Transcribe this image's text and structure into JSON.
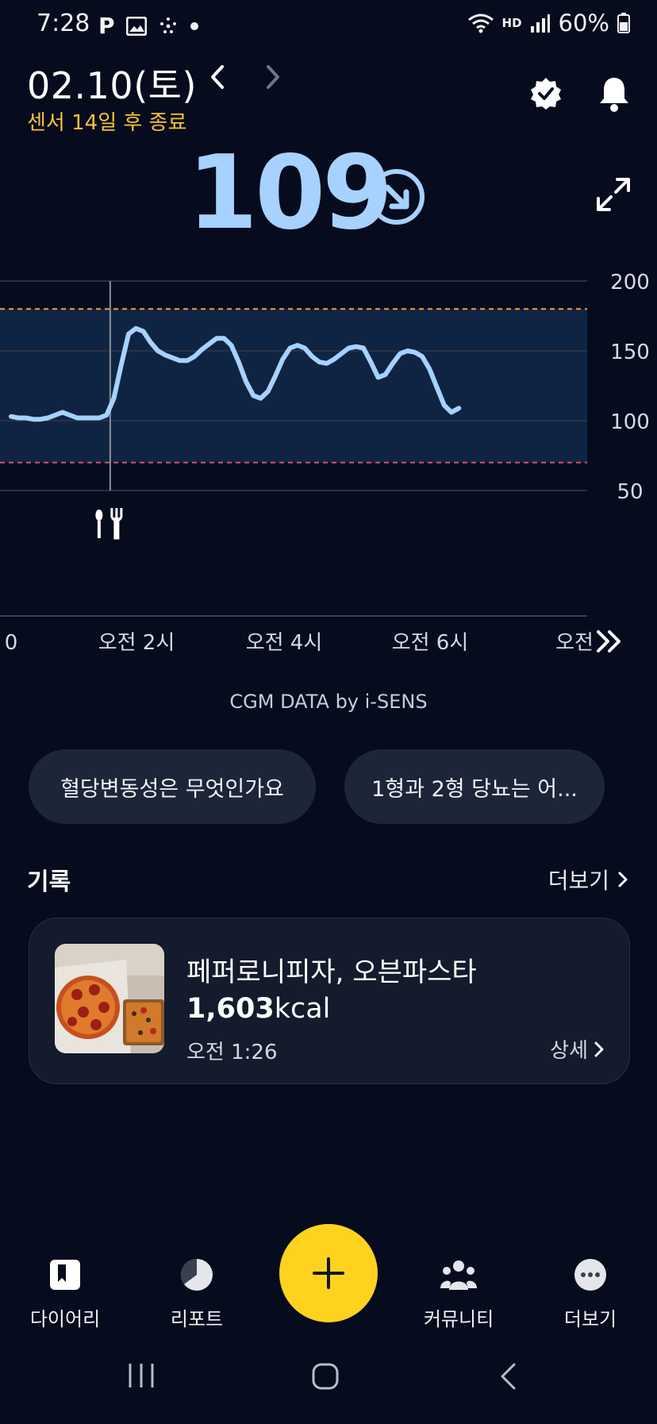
{
  "status_bar": {
    "time": "7:28",
    "battery": "60%",
    "network_label": "HD"
  },
  "header": {
    "date": "02.10(토)",
    "sensor_notice": "센서 14일 후 종료"
  },
  "glucose": {
    "value": "109",
    "trend": "falling"
  },
  "chart_data": {
    "type": "line",
    "yticks": [
      200,
      150,
      100,
      50
    ],
    "ylim": [
      35,
      200
    ],
    "xticks": [
      "0",
      "오전 2시",
      "오전 4시",
      "오전 6시",
      "오전"
    ],
    "target_range": [
      70,
      180
    ],
    "hours": [
      0.0,
      0.1,
      0.2,
      0.3,
      0.4,
      0.5,
      0.6,
      0.7,
      0.8,
      0.9,
      1.0,
      1.1,
      1.2,
      1.3,
      1.4,
      1.5,
      1.6,
      1.7,
      1.8,
      1.9,
      2.0,
      2.1,
      2.2,
      2.3,
      2.4,
      2.5,
      2.6,
      2.7,
      2.8,
      2.9,
      3.0,
      3.1,
      3.2,
      3.3,
      3.4,
      3.5,
      3.6,
      3.7,
      3.8,
      3.9,
      4.0,
      4.1,
      4.2,
      4.3,
      4.4,
      4.5,
      4.6,
      4.7,
      4.8,
      4.9,
      5.0,
      5.1,
      5.2,
      5.3,
      5.4,
      5.5,
      5.6,
      5.7,
      5.8,
      5.9,
      6.0,
      6.1,
      6.2,
      6.3,
      6.4,
      6.5,
      6.6,
      6.7,
      6.8,
      6.9,
      7.0,
      7.1,
      7.2
    ],
    "values": [
      103,
      102,
      102,
      101,
      101,
      102,
      104,
      106,
      104,
      102,
      102,
      102,
      102,
      104,
      116,
      140,
      162,
      166,
      164,
      156,
      150,
      147,
      145,
      143,
      143,
      146,
      151,
      155,
      159,
      159,
      154,
      142,
      128,
      118,
      116,
      121,
      132,
      144,
      152,
      154,
      152,
      146,
      142,
      141,
      144,
      148,
      152,
      153,
      152,
      142,
      131,
      133,
      141,
      148,
      150,
      149,
      146,
      137,
      124,
      111,
      106,
      109
    ],
    "meal_marker_hour": 1.35,
    "cursor_hour": 1.35
  },
  "chart_caption": "CGM DATA by i-SENS",
  "chips": [
    "혈당변동성은 무엇인가요",
    "1형과 2형 당뇨는 어..."
  ],
  "records": {
    "title": "기록",
    "more": "더보기",
    "item": {
      "name": "페퍼로니피자, 오븐파스타",
      "kcal_value": "1,603",
      "kcal_unit": "kcal",
      "time": "오전 1:26",
      "detail": "상세"
    }
  },
  "bottom_nav": [
    {
      "label": "다이어리",
      "icon": "diary-icon"
    },
    {
      "label": "리포트",
      "icon": "report-icon"
    },
    {
      "label": "커뮤니티",
      "icon": "community-icon"
    },
    {
      "label": "더보기",
      "icon": "more-dots-icon"
    }
  ],
  "colors": {
    "accent": "#ffd21f",
    "glucose": "#a7d1ff",
    "high_line": "#f0a23a",
    "low_line": "#e14b6b"
  }
}
